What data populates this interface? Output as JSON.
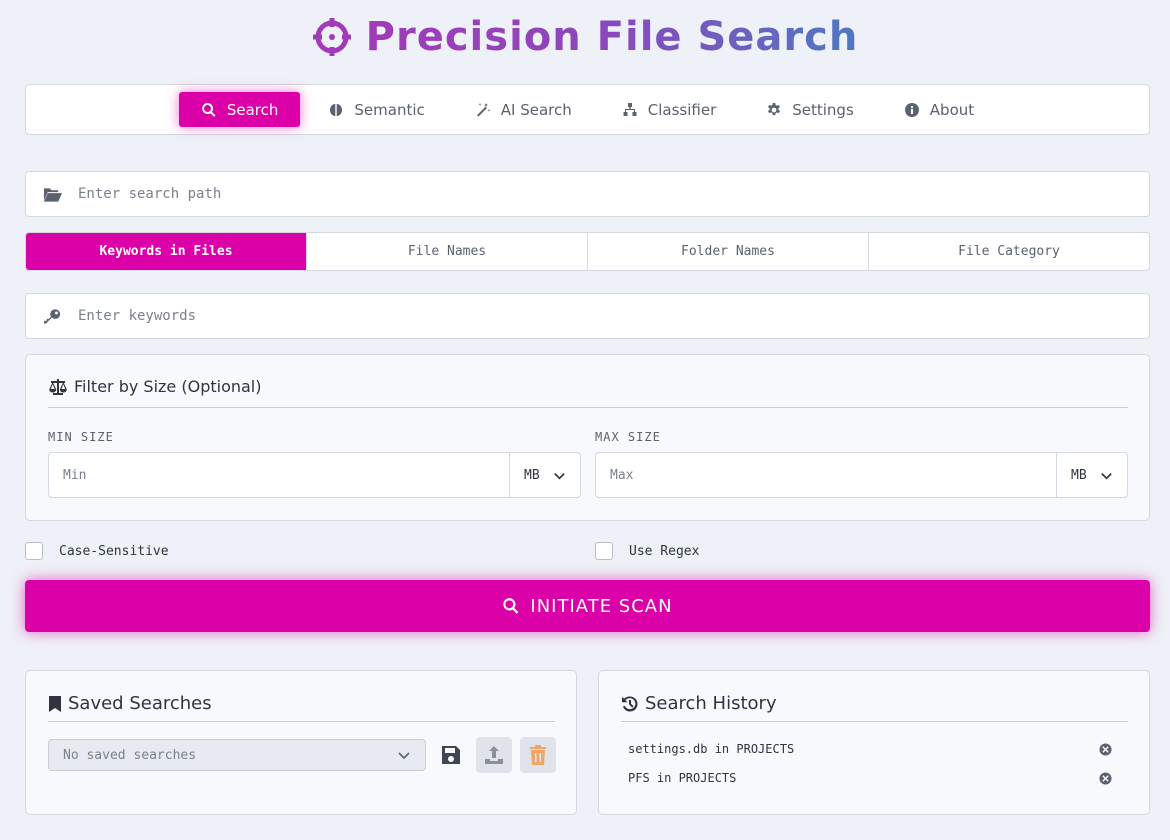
{
  "app": {
    "title": "Precision File Search"
  },
  "nav": {
    "items": [
      {
        "label": "Search",
        "icon": "search-icon",
        "active": true
      },
      {
        "label": "Semantic",
        "icon": "brain-icon",
        "active": false
      },
      {
        "label": "AI Search",
        "icon": "magic-wand-icon",
        "active": false
      },
      {
        "label": "Classifier",
        "icon": "sitemap-icon",
        "active": false
      },
      {
        "label": "Settings",
        "icon": "gear-icon",
        "active": false
      },
      {
        "label": "About",
        "icon": "info-icon",
        "active": false
      }
    ]
  },
  "path": {
    "placeholder": "Enter search path",
    "value": ""
  },
  "modes": {
    "items": [
      "Keywords in Files",
      "File Names",
      "Folder Names",
      "File Category"
    ],
    "selected": "Keywords in Files"
  },
  "keywords": {
    "placeholder": "Enter keywords",
    "value": ""
  },
  "filter": {
    "title": "Filter by Size (Optional)",
    "min_label": "MIN SIZE",
    "min_placeholder": "Min",
    "min_unit": "MB",
    "max_label": "MAX SIZE",
    "max_placeholder": "Max",
    "max_unit": "MB"
  },
  "options": {
    "case_sensitive": "Case-Sensitive",
    "use_regex": "Use Regex"
  },
  "scan_button": "INITIATE SCAN",
  "saved": {
    "title": "Saved Searches",
    "selected": "No saved searches"
  },
  "history": {
    "title": "Search History",
    "items": [
      "settings.db in PROJECTS",
      "PFS in PROJECTS"
    ]
  },
  "colors": {
    "accent": "#db00a8",
    "title_gradient_start": "#a23bb8",
    "title_gradient_end": "#4f78c2",
    "background": "#eef1f7"
  }
}
